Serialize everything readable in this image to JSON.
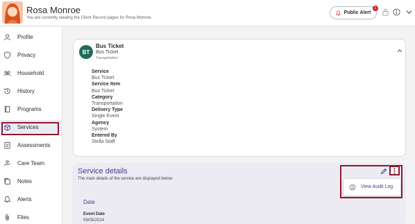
{
  "header": {
    "client_name": "Rosa Monroe",
    "client_subtitle": "You are currently viewing the Client Record pages for Rosa Monroe.",
    "public_alert_label": "Public Alert",
    "alert_count": "1"
  },
  "sidebar": {
    "items": [
      {
        "label": "Profile",
        "icon": "person-icon"
      },
      {
        "label": "Privacy",
        "icon": "shield-icon"
      },
      {
        "label": "Household",
        "icon": "people-icon"
      },
      {
        "label": "History",
        "icon": "history-icon"
      },
      {
        "label": "Programs",
        "icon": "book-icon"
      },
      {
        "label": "Services",
        "icon": "services-icon"
      },
      {
        "label": "Assessments",
        "icon": "clipboard-icon"
      },
      {
        "label": "Care Team",
        "icon": "care-team-icon"
      },
      {
        "label": "Notes",
        "icon": "notes-icon"
      },
      {
        "label": "Alerts",
        "icon": "bell-icon"
      },
      {
        "label": "Files",
        "icon": "paperclip-icon"
      }
    ],
    "active": "Services"
  },
  "service_card": {
    "avatar_initials": "BT",
    "title": "Bus Ticket",
    "subtitle": "Bus Ticket",
    "category": "Transportation",
    "fields": [
      {
        "label": "Service",
        "value": "Bus Ticket"
      },
      {
        "label": "Service Item",
        "value": "Bus Ticket"
      },
      {
        "label": "Category",
        "value": "Transportation"
      },
      {
        "label": "Delivery Type",
        "value": "Single Event"
      },
      {
        "label": "Agency",
        "value": "System"
      },
      {
        "label": "Entered By",
        "value": "Stella Staff"
      }
    ]
  },
  "service_details": {
    "title": "Service details",
    "description": "The main details of the service are displayed below",
    "date_heading": "Date",
    "event_date_label": "Event Date",
    "event_date_value": "09/05/2024",
    "audit_log_label": "View Audit Log"
  },
  "colors": {
    "accent": "#3f3f8f",
    "highlight": "#8b1a2b",
    "avatar_green": "#1e6b5a",
    "badge_red": "#c62828"
  }
}
